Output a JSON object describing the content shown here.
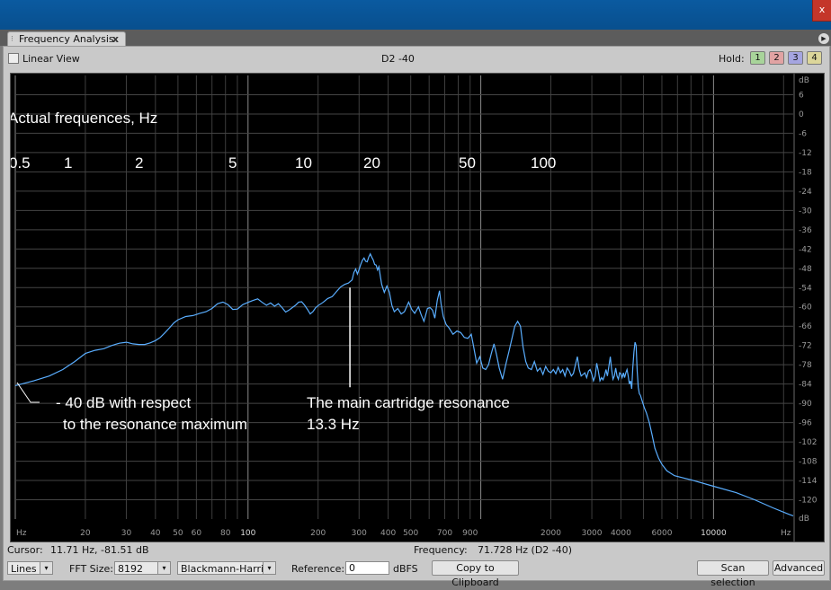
{
  "window": {
    "close_label": "x"
  },
  "tab": {
    "label": "Frequency Analysis",
    "close": "x",
    "grip": "⁝"
  },
  "options": {
    "linear_view": "Linear View",
    "linear_view_checked": false,
    "center_title": "D2 -40",
    "hold_label": "Hold:",
    "hold_buttons": [
      "1",
      "2",
      "3",
      "4"
    ],
    "hold_colors": [
      "#a8d49a",
      "#e1a3a3",
      "#a5a5e0",
      "#dcd69a"
    ]
  },
  "annotations": {
    "actual_freq_title": "Actual frequences, Hz",
    "actual_freq_ticks": [
      "0.5",
      "1",
      "2",
      "5",
      "10",
      "20",
      "50",
      "100"
    ],
    "left_note_line1": "- 40 dB with respect",
    "left_note_line2": "to the resonance maximum",
    "right_note_line1": "The main cartridge resonance",
    "right_note_line2": "13.3 Hz"
  },
  "chart_data": {
    "type": "line",
    "x_scale": "log",
    "xlabel": "Hz",
    "ylabel": "dB",
    "xlim": [
      10,
      22000
    ],
    "ylim": [
      -126,
      12
    ],
    "grid": true,
    "line_color": "#5aaeff",
    "x_tick_labels": [
      {
        "v": 20,
        "t": "20"
      },
      {
        "v": 30,
        "t": "30"
      },
      {
        "v": 40,
        "t": "40"
      },
      {
        "v": 50,
        "t": "50"
      },
      {
        "v": 60,
        "t": "60"
      },
      {
        "v": 80,
        "t": "80"
      },
      {
        "v": 100,
        "t": "100"
      },
      {
        "v": 200,
        "t": "200"
      },
      {
        "v": 300,
        "t": "300"
      },
      {
        "v": 400,
        "t": "400"
      },
      {
        "v": 500,
        "t": "500"
      },
      {
        "v": 700,
        "t": "700"
      },
      {
        "v": 900,
        "t": "900"
      },
      {
        "v": 2000,
        "t": "2000"
      },
      {
        "v": 3000,
        "t": "3000"
      },
      {
        "v": 4000,
        "t": "4000"
      },
      {
        "v": 6000,
        "t": "6000"
      },
      {
        "v": 10000,
        "t": "10000"
      }
    ],
    "x_axis_start_label": "Hz",
    "x_axis_end_label": "Hz",
    "y_ticks": [
      6,
      0,
      -6,
      -12,
      -18,
      -24,
      -30,
      -36,
      -42,
      -48,
      -54,
      -60,
      -66,
      -72,
      -78,
      -84,
      -90,
      -96,
      -102,
      -108,
      -114,
      -120
    ],
    "y_unit_label": "dB",
    "series": [
      {
        "points": [
          [
            10,
            -84.5
          ],
          [
            12,
            -83
          ],
          [
            14,
            -81.5
          ],
          [
            16,
            -79.5
          ],
          [
            18,
            -77
          ],
          [
            20,
            -74.5
          ],
          [
            22,
            -73.5
          ],
          [
            24,
            -73
          ],
          [
            26,
            -72
          ],
          [
            28,
            -71.3
          ],
          [
            30,
            -71
          ],
          [
            32,
            -71.5
          ],
          [
            34,
            -71.7
          ],
          [
            36,
            -71.7
          ],
          [
            38,
            -71.2
          ],
          [
            40,
            -70.5
          ],
          [
            42,
            -69.5
          ],
          [
            44,
            -68
          ],
          [
            46,
            -66.5
          ],
          [
            48,
            -65
          ],
          [
            50,
            -64
          ],
          [
            54,
            -63
          ],
          [
            58,
            -62.7
          ],
          [
            62,
            -62
          ],
          [
            66,
            -61.5
          ],
          [
            70,
            -60.5
          ],
          [
            74,
            -59
          ],
          [
            78,
            -58.5
          ],
          [
            82,
            -59.3
          ],
          [
            86,
            -60.8
          ],
          [
            90,
            -60.7
          ],
          [
            95,
            -59.3
          ],
          [
            100,
            -58.6
          ],
          [
            105,
            -58
          ],
          [
            110,
            -57.5
          ],
          [
            115,
            -58.6
          ],
          [
            120,
            -59.5
          ],
          [
            125,
            -58.8
          ],
          [
            130,
            -59.8
          ],
          [
            135,
            -59
          ],
          [
            140,
            -60.2
          ],
          [
            145,
            -61.6
          ],
          [
            150,
            -61
          ],
          [
            155,
            -60.2
          ],
          [
            160,
            -59.5
          ],
          [
            165,
            -58.5
          ],
          [
            170,
            -58.4
          ],
          [
            175,
            -59.5
          ],
          [
            180,
            -60.8
          ],
          [
            185,
            -62.2
          ],
          [
            190,
            -61.5
          ],
          [
            195,
            -60.3
          ],
          [
            200,
            -59.6
          ],
          [
            210,
            -58.6
          ],
          [
            220,
            -57.4
          ],
          [
            230,
            -56.8
          ],
          [
            240,
            -55.2
          ],
          [
            250,
            -53.8
          ],
          [
            260,
            -53
          ],
          [
            270,
            -52.6
          ],
          [
            280,
            -51.6
          ],
          [
            285,
            -49.3
          ],
          [
            290,
            -48.2
          ],
          [
            295,
            -49.8
          ],
          [
            300,
            -48.3
          ],
          [
            305,
            -46.8
          ],
          [
            310,
            -45.5
          ],
          [
            315,
            -44.8
          ],
          [
            320,
            -45.8
          ],
          [
            325,
            -46
          ],
          [
            330,
            -44.5
          ],
          [
            335,
            -43.5
          ],
          [
            340,
            -44.5
          ],
          [
            345,
            -45.4
          ],
          [
            350,
            -46.8
          ],
          [
            355,
            -47
          ],
          [
            360,
            -48.5
          ],
          [
            365,
            -47.5
          ],
          [
            370,
            -50.3
          ],
          [
            375,
            -53
          ],
          [
            385,
            -55.5
          ],
          [
            395,
            -53.5
          ],
          [
            405,
            -55.5
          ],
          [
            415,
            -59.5
          ],
          [
            425,
            -61.5
          ],
          [
            440,
            -60.5
          ],
          [
            455,
            -62.2
          ],
          [
            470,
            -61.5
          ],
          [
            490,
            -58.5
          ],
          [
            505,
            -60.8
          ],
          [
            520,
            -62
          ],
          [
            540,
            -60
          ],
          [
            555,
            -62.5
          ],
          [
            570,
            -64.5
          ],
          [
            590,
            -60.5
          ],
          [
            605,
            -60.2
          ],
          [
            620,
            -61
          ],
          [
            635,
            -63.5
          ],
          [
            650,
            -58
          ],
          [
            665,
            -55
          ],
          [
            675,
            -59
          ],
          [
            690,
            -63
          ],
          [
            710,
            -65.5
          ],
          [
            730,
            -66.5
          ],
          [
            760,
            -68.5
          ],
          [
            790,
            -67.5
          ],
          [
            820,
            -68
          ],
          [
            850,
            -69.5
          ],
          [
            880,
            -69.8
          ],
          [
            910,
            -68.5
          ],
          [
            930,
            -72
          ],
          [
            960,
            -77.5
          ],
          [
            990,
            -75.5
          ],
          [
            1020,
            -79
          ],
          [
            1050,
            -79.5
          ],
          [
            1080,
            -78
          ],
          [
            1110,
            -74.5
          ],
          [
            1140,
            -71.5
          ],
          [
            1170,
            -75
          ],
          [
            1200,
            -79
          ],
          [
            1240,
            -82.5
          ],
          [
            1280,
            -78
          ],
          [
            1320,
            -74
          ],
          [
            1360,
            -70
          ],
          [
            1400,
            -66
          ],
          [
            1440,
            -64.5
          ],
          [
            1480,
            -66
          ],
          [
            1520,
            -72.5
          ],
          [
            1560,
            -77
          ],
          [
            1600,
            -79
          ],
          [
            1650,
            -79.5
          ],
          [
            1700,
            -77
          ],
          [
            1750,
            -80
          ],
          [
            1800,
            -79
          ],
          [
            1850,
            -81
          ],
          [
            1900,
            -78.5
          ],
          [
            1950,
            -80
          ],
          [
            2000,
            -80.5
          ],
          [
            2050,
            -79.5
          ],
          [
            2100,
            -80.8
          ],
          [
            2150,
            -78.8
          ],
          [
            2200,
            -80.5
          ],
          [
            2250,
            -79.5
          ],
          [
            2300,
            -81.5
          ],
          [
            2350,
            -79
          ],
          [
            2400,
            -80
          ],
          [
            2450,
            -81.5
          ],
          [
            2500,
            -80.7
          ],
          [
            2550,
            -78
          ],
          [
            2600,
            -75.5
          ],
          [
            2650,
            -79.5
          ],
          [
            2700,
            -81.5
          ],
          [
            2750,
            -81
          ],
          [
            2800,
            -80.5
          ],
          [
            2850,
            -82
          ],
          [
            2900,
            -80
          ],
          [
            2950,
            -79.5
          ],
          [
            3000,
            -81
          ],
          [
            3050,
            -83
          ],
          [
            3100,
            -81.5
          ],
          [
            3150,
            -77.5
          ],
          [
            3200,
            -80
          ],
          [
            3250,
            -83
          ],
          [
            3300,
            -82
          ],
          [
            3350,
            -82.7
          ],
          [
            3400,
            -81.5
          ],
          [
            3450,
            -79.5
          ],
          [
            3500,
            -81.5
          ],
          [
            3550,
            -78.5
          ],
          [
            3600,
            -75.5
          ],
          [
            3650,
            -79.5
          ],
          [
            3700,
            -82.5
          ],
          [
            3750,
            -81.5
          ],
          [
            3800,
            -79
          ],
          [
            3850,
            -81.5
          ],
          [
            3900,
            -82.5
          ],
          [
            3950,
            -80.5
          ],
          [
            4000,
            -80.8
          ],
          [
            4050,
            -82
          ],
          [
            4100,
            -80.5
          ],
          [
            4150,
            -82
          ],
          [
            4200,
            -80.5
          ],
          [
            4250,
            -79.5
          ],
          [
            4300,
            -81.5
          ],
          [
            4350,
            -84
          ],
          [
            4400,
            -83
          ],
          [
            4450,
            -85.5
          ],
          [
            4500,
            -79
          ],
          [
            4550,
            -74
          ],
          [
            4600,
            -71
          ],
          [
            4650,
            -72
          ],
          [
            4700,
            -80
          ],
          [
            4750,
            -85
          ],
          [
            4800,
            -87
          ],
          [
            4850,
            -87.5
          ],
          [
            4950,
            -89.5
          ],
          [
            5050,
            -91.5
          ],
          [
            5150,
            -93
          ],
          [
            5300,
            -96
          ],
          [
            5450,
            -100
          ],
          [
            5600,
            -104
          ],
          [
            5800,
            -107
          ],
          [
            6000,
            -109
          ],
          [
            6300,
            -111
          ],
          [
            6800,
            -112.5
          ],
          [
            8000,
            -113.8
          ],
          [
            10000,
            -115.8
          ],
          [
            12500,
            -117.8
          ],
          [
            15000,
            -120
          ],
          [
            18000,
            -122.5
          ],
          [
            21000,
            -124.5
          ],
          [
            22000,
            -125
          ]
        ]
      }
    ],
    "markers": [
      {
        "x": 274,
        "y_top": -54,
        "y_bottom": -85,
        "color": "#ffffff"
      }
    ]
  },
  "status": {
    "cursor_label": "Cursor:",
    "cursor_value": "11.71 Hz, -81.51 dB",
    "frequency_label": "Frequency:",
    "frequency_value": "71.728 Hz (D2 -40)"
  },
  "controls": {
    "mode_value": "Lines",
    "fft_label": "FFT Size:",
    "fft_value": "8192",
    "window_value": "Blackmann-Harris",
    "reference_label": "Reference:",
    "reference_value": "0",
    "reference_unit": "dBFS",
    "copy_button": "Copy to Clipboard",
    "scan_button": "Scan selection",
    "advanced_button": "Advanced",
    "dropdown_arrow": "▾"
  }
}
